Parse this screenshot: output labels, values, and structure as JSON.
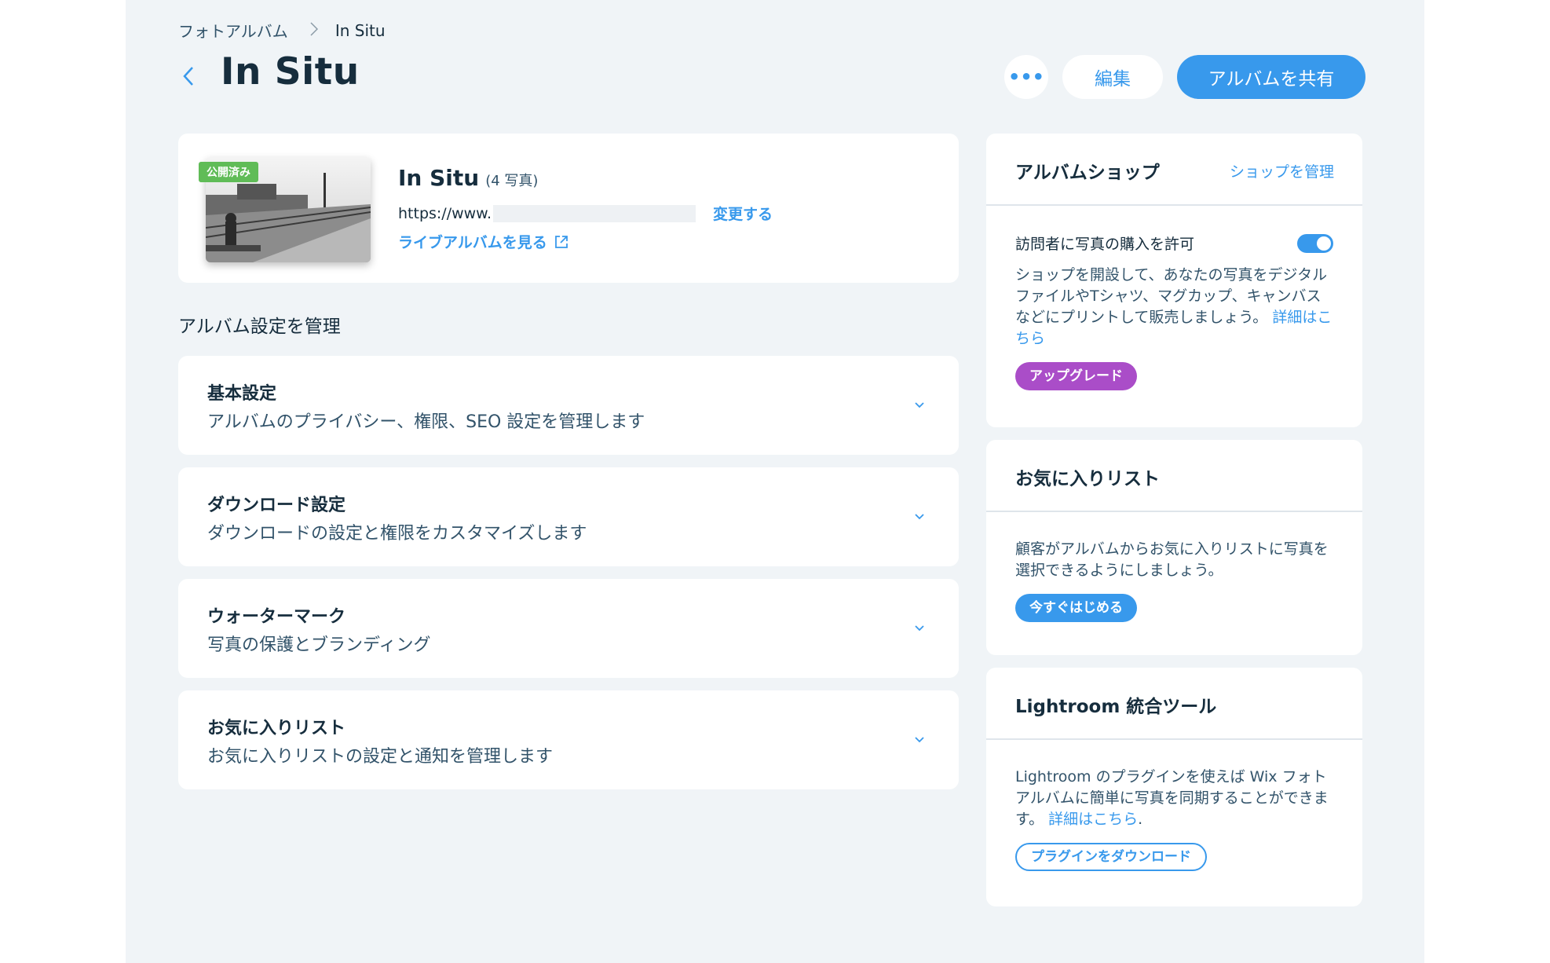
{
  "breadcrumb": {
    "root": "フォトアルバム",
    "current": "In Situ"
  },
  "header": {
    "title": "In Situ",
    "more_label": "•••",
    "edit_label": "編集",
    "share_label": "アルバムを共有"
  },
  "album": {
    "status_badge": "公開済み",
    "name": "In Situ",
    "photo_count": "(4 写真)",
    "url_prefix": "https://www.",
    "change_label": "変更する",
    "live_label": "ライブアルバムを見る"
  },
  "settings": {
    "section_label": "アルバム設定を管理",
    "items": [
      {
        "title": "基本設定",
        "desc": "アルバムのプライバシー、権限、SEO 設定を管理します"
      },
      {
        "title": "ダウンロード設定",
        "desc": "ダウンロードの設定と権限をカスタマイズします"
      },
      {
        "title": "ウォーターマーク",
        "desc": "写真の保護とブランディング"
      },
      {
        "title": "お気に入りリスト",
        "desc": "お気に入りリストの設定と通知を管理します"
      }
    ]
  },
  "shop": {
    "title": "アルバムショップ",
    "manage_link": "ショップを管理",
    "toggle_label": "訪問者に写真の購入を許可",
    "toggle_on": true,
    "text": "ショップを開設して、あなたの写真をデジタルファイルやTシャツ、マグカップ、キャンバスなどにプリントして販売しましょう。",
    "learn_more": "詳細はこちら",
    "upgrade_label": "アップグレード"
  },
  "favorites": {
    "title": "お気に入りリスト",
    "text": "顧客がアルバムからお気に入りリストに写真を選択できるようにしましょう。",
    "start_label": "今すぐはじめる"
  },
  "lightroom": {
    "title": "Lightroom 統合ツール",
    "text": "Lightroom のプラグインを使えば Wix フォトアルバムに簡単に写真を同期することができます。",
    "learn_more": "詳細はこちら",
    "trailing": ".",
    "download_label": "プラグインをダウンロード"
  },
  "colors": {
    "accent": "#3899ec",
    "published": "#60bc57",
    "upgrade": "#aa4dc8",
    "background": "#f0f4f7"
  }
}
